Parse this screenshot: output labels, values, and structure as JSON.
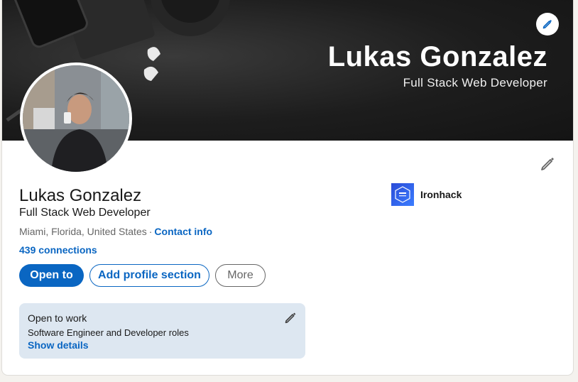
{
  "banner": {
    "name": "Lukas Gonzalez",
    "headline": "Full Stack Web Developer"
  },
  "profile": {
    "name": "Lukas Gonzalez",
    "headline": "Full Stack Web Developer",
    "location": "Miami, Florida, United States",
    "separator": "·",
    "contact_info": "Contact info",
    "connections": "439 connections"
  },
  "actions": {
    "open_to": "Open to",
    "add_profile_section": "Add profile section",
    "more": "More"
  },
  "company": {
    "name": "Ironhack",
    "logo_icon": "ironhack-logo-icon"
  },
  "open_to_work": {
    "title": "Open to work",
    "roles": "Software Engineer and Developer roles",
    "show_details": "Show details"
  },
  "colors": {
    "primary": "#0a66c2",
    "otw_background": "#dde7f1",
    "banner": "#1d1d1d"
  },
  "icons": {
    "banner_edit": "pencil-icon",
    "intro_edit": "pencil-icon",
    "otw_edit": "pencil-icon"
  }
}
